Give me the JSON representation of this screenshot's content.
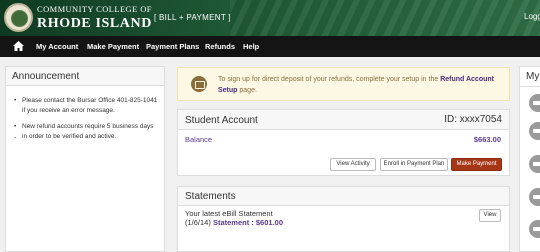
{
  "header": {
    "brand_top": "COMMUNITY COLLEGE OF",
    "brand_main": "RHODE ISLAND",
    "system_name": "[ BILL + PAYMENT ]",
    "login_label": "Logg"
  },
  "nav": {
    "items": [
      {
        "label": "My Account"
      },
      {
        "label": "Make Payment"
      },
      {
        "label": "Payment Plans"
      },
      {
        "label": "Refunds"
      },
      {
        "label": "Help"
      }
    ]
  },
  "announcement": {
    "title": "Announcement",
    "items": [
      "Please contact the Bursar Office 401-825-1041 if you receive an error message.",
      "New refund accounts require 5 business days in order to be verified and active."
    ],
    "trailing": "-"
  },
  "alert": {
    "text_before": "To sign up for direct deposit of your refunds, complete your setup in the ",
    "link": "Refund Account Setup",
    "text_after": " page."
  },
  "student_account": {
    "title": "Student Account",
    "id_text": "ID: xxxx7054",
    "balance_label": "Balance",
    "balance_value": "$663.00",
    "buttons": {
      "view_activity": "View Activity",
      "enroll": "Enroll in Payment Plan",
      "make_payment": "Make Payment"
    }
  },
  "statements": {
    "title": "Statements",
    "line1": "Your latest eBill Statement",
    "date": "(1/6/14)",
    "statement_link": "Statement :",
    "amount": "$601.00",
    "view": "View"
  },
  "right_panel": {
    "title": "My"
  },
  "colors": {
    "header_green": "#1f5a36",
    "nav_black": "#141414",
    "primary_button": "#a53717",
    "link_purple": "#5a3a8a",
    "alert_bg": "#fcf8e3"
  }
}
